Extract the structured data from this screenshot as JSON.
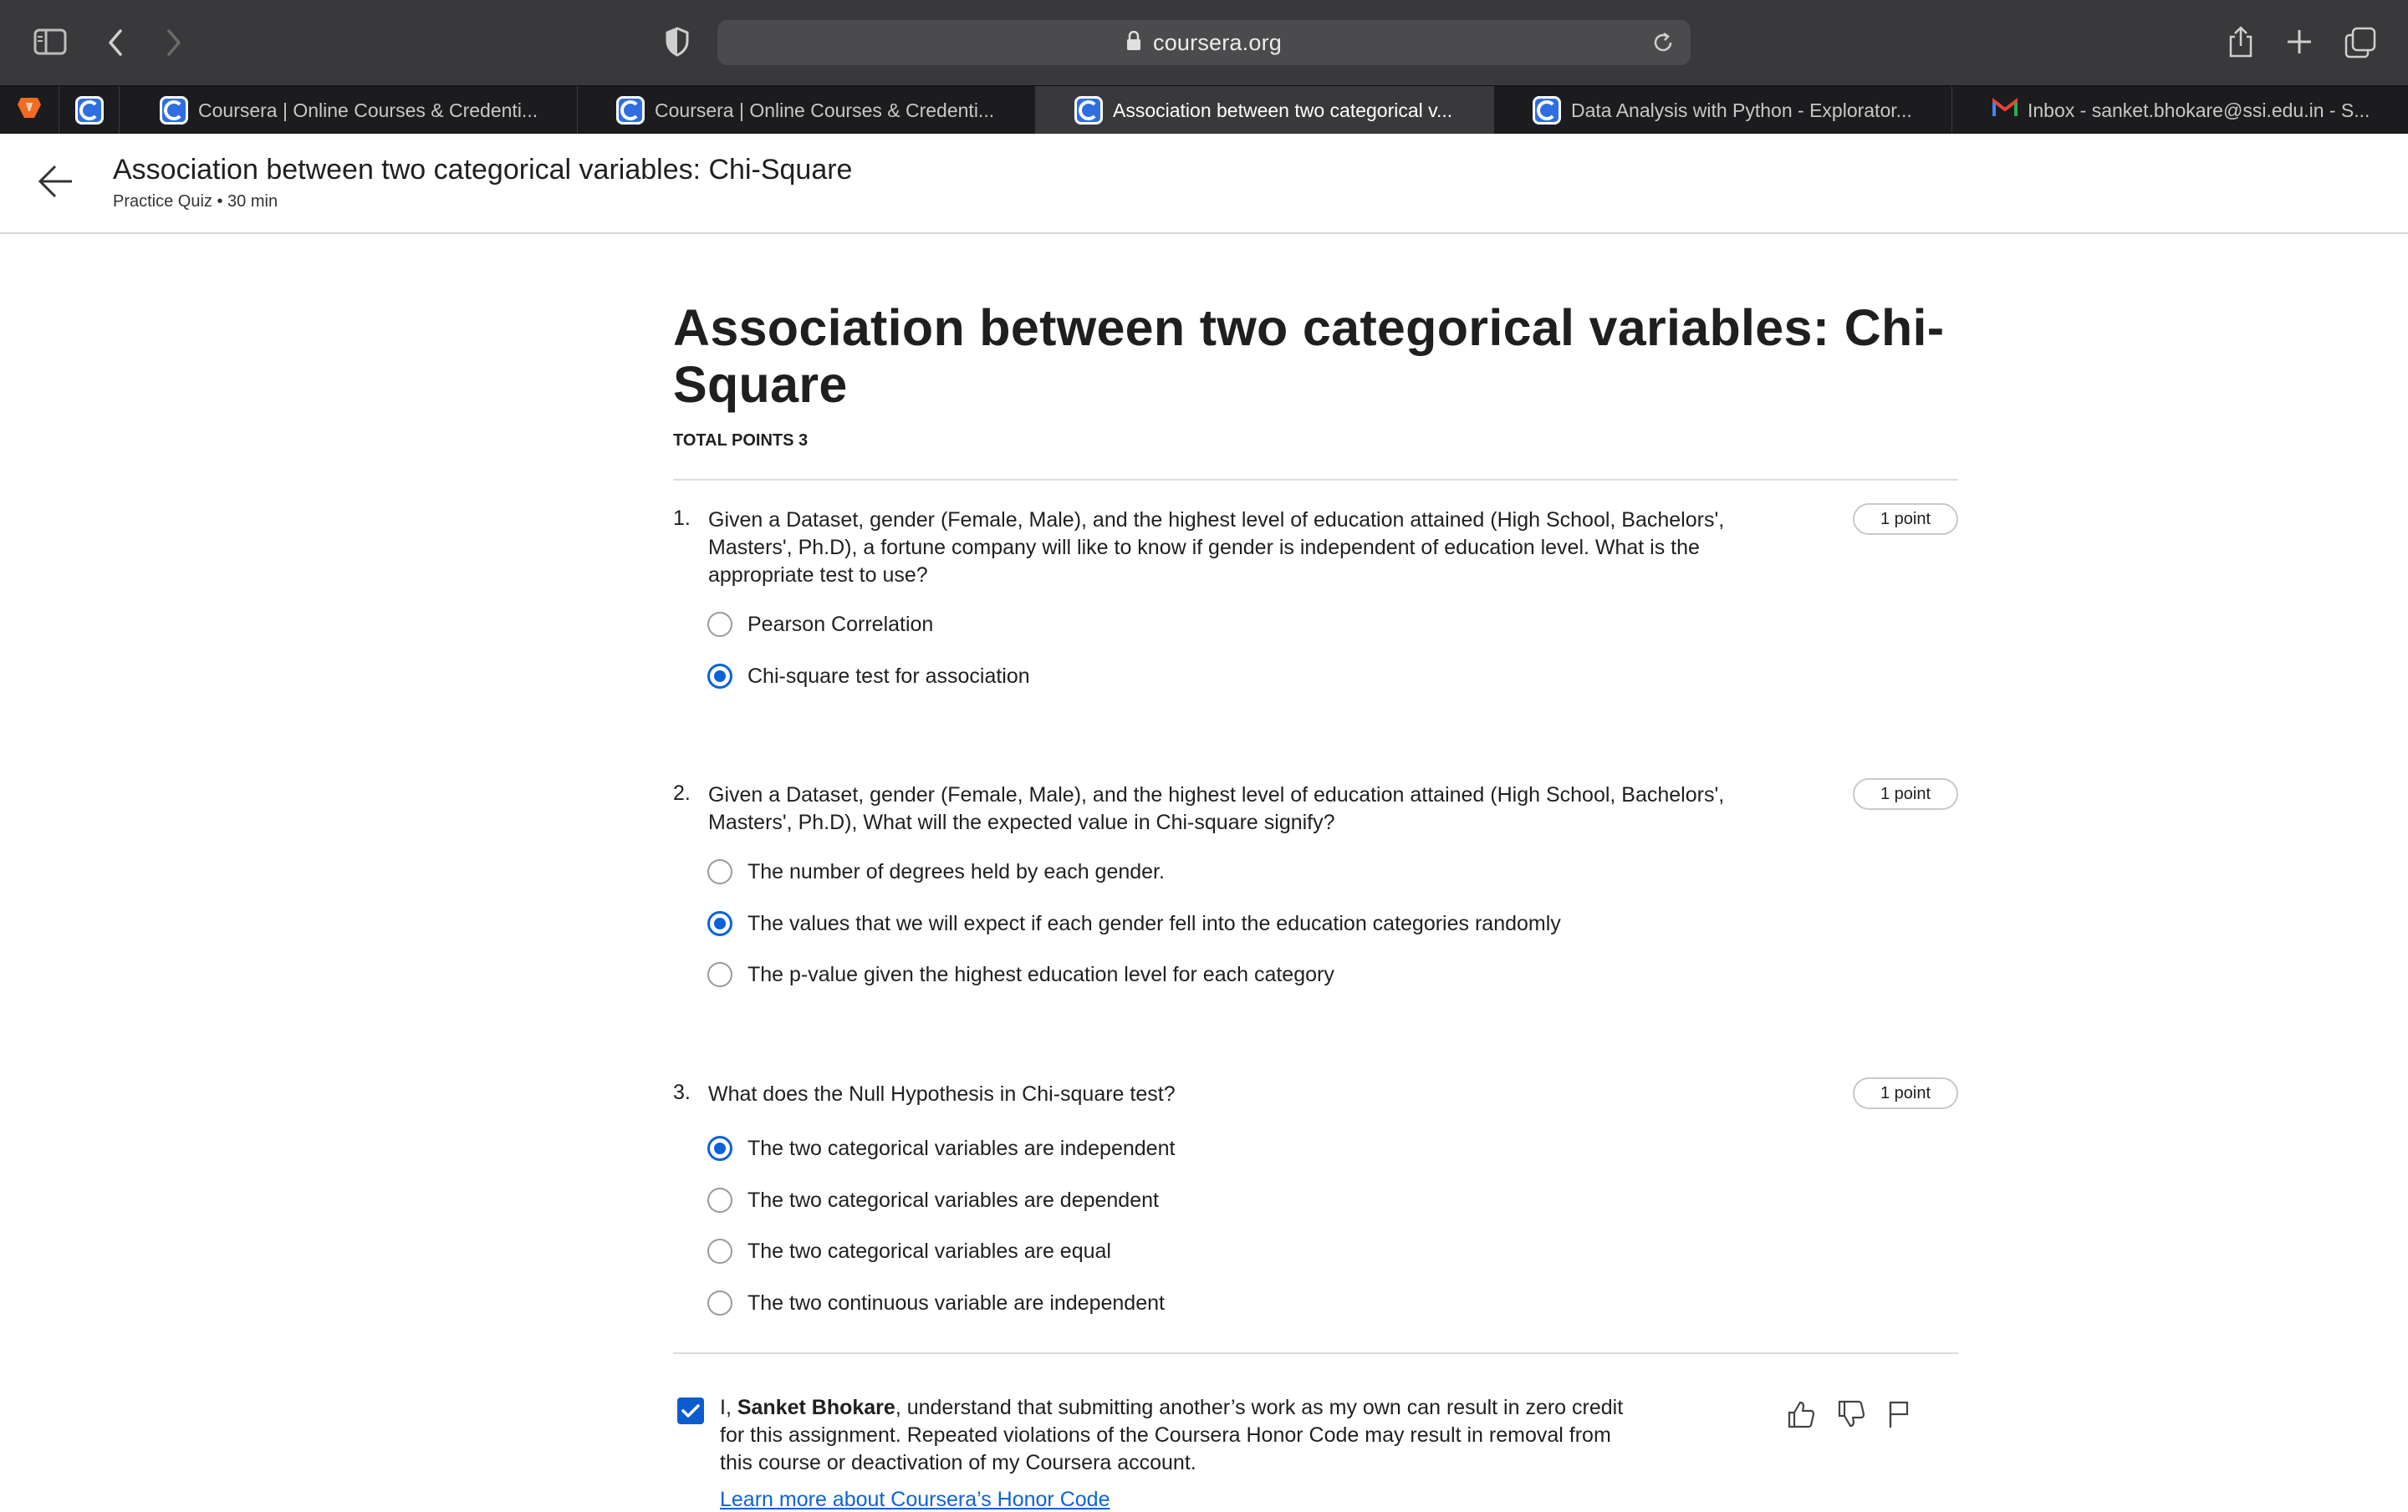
{
  "browser": {
    "url": "coursera.org",
    "tabs": [
      {
        "label": "Coursera | Online Courses & Credenti...",
        "active": false
      },
      {
        "label": "Coursera | Online Courses & Credenti...",
        "active": false
      },
      {
        "label": "Association between two categorical v...",
        "active": true
      },
      {
        "label": "Data Analysis with Python - Explorator...",
        "active": false
      },
      {
        "label": "Inbox - sanket.bhokare@ssi.edu.in - S...",
        "active": false
      }
    ]
  },
  "header": {
    "title": "Association between two categorical variables: Chi-Square",
    "subtitle": "Practice Quiz • 30 min"
  },
  "quiz": {
    "title": "Association between two categorical variables: Chi-Square",
    "total_points": "TOTAL POINTS 3",
    "questions": [
      {
        "number": "1.",
        "text": "Given a Dataset, gender (Female, Male), and the highest level of education attained (High School, Bachelors', Masters', Ph.D), a fortune company will like to know if gender is independent of education level. What is the appropriate test to use?",
        "points": "1 point",
        "options": [
          {
            "label": "Pearson Correlation",
            "selected": false
          },
          {
            "label": "Chi-square test for association",
            "selected": true
          }
        ]
      },
      {
        "number": "2.",
        "text": "Given a Dataset, gender (Female, Male), and the highest level of education attained (High School, Bachelors', Masters', Ph.D), What will the expected value in Chi-square signify?",
        "points": "1 point",
        "options": [
          {
            "label": "The number of degrees held by each gender.",
            "selected": false
          },
          {
            "label": "The values that we will expect if each gender fell into the education categories randomly",
            "selected": true
          },
          {
            "label": "The p-value given the highest education level for each category",
            "selected": false
          }
        ]
      },
      {
        "number": "3.",
        "text": "What does the Null Hypothesis in Chi-square test?",
        "points": "1 point",
        "options": [
          {
            "label": "The two categorical variables are independent",
            "selected": true
          },
          {
            "label": "The two categorical variables are dependent",
            "selected": false
          },
          {
            "label": "The two categorical variables are equal",
            "selected": false
          },
          {
            "label": "The two continuous variable are independent",
            "selected": false
          }
        ]
      }
    ]
  },
  "honor": {
    "checked": true,
    "prefix": "I, ",
    "name": "Sanket Bhokare",
    "suffix": ", understand that submitting another’s work as my own can result in zero credit for this assignment. Repeated violations of the Coursera Honor Code may result in removal from this course or deactivation of my Coursera account.",
    "link": "Learn more about Coursera’s Honor Code"
  },
  "colors": {
    "accent": "#0b63d8",
    "toolbar": "#39393b",
    "tabbar": "#1c1c1e"
  }
}
